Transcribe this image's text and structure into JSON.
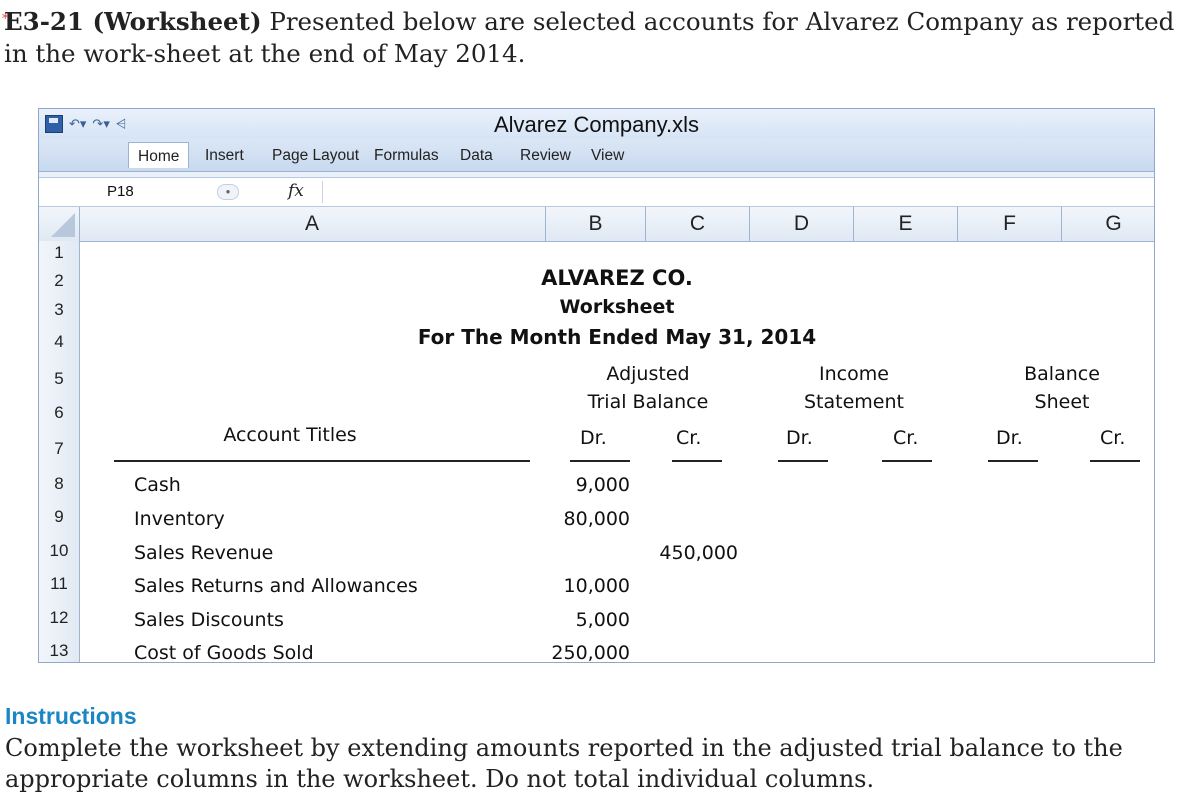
{
  "problem": {
    "label": "E3-21 (Worksheet)",
    "text": "Presented below are selected accounts for Alvarez Company as reported in the work-sheet at the end of May 2014."
  },
  "excel": {
    "window_title": "Alvarez Company.xls",
    "tabs": [
      "Home",
      "Insert",
      "Page Layout",
      "Formulas",
      "Data",
      "Review",
      "View"
    ],
    "active_tab": "Home",
    "name_box": "P18",
    "fx_label": "fx",
    "columns": [
      "A",
      "B",
      "C",
      "D",
      "E",
      "F",
      "G"
    ],
    "rows": [
      "1",
      "2",
      "3",
      "4",
      "5",
      "6",
      "7",
      "8",
      "9",
      "10",
      "11",
      "12",
      "13"
    ],
    "header": {
      "company": "ALVAREZ CO.",
      "report": "Worksheet",
      "period": "For The Month Ended May 31, 2014"
    },
    "groups": {
      "atb_line1": "Adjusted",
      "atb_line2": "Trial Balance",
      "is_line1": "Income",
      "is_line2": "Statement",
      "bs_line1": "Balance",
      "bs_line2": "Sheet"
    },
    "col_titles": {
      "account": "Account Titles",
      "dr": "Dr.",
      "cr": "Cr."
    },
    "accounts": [
      {
        "name": "Cash",
        "dr": "9,000",
        "cr": ""
      },
      {
        "name": "Inventory",
        "dr": "80,000",
        "cr": ""
      },
      {
        "name": "Sales Revenue",
        "dr": "",
        "cr": "450,000"
      },
      {
        "name": "Sales Returns and Allowances",
        "dr": "10,000",
        "cr": ""
      },
      {
        "name": "Sales Discounts",
        "dr": "5,000",
        "cr": ""
      },
      {
        "name": "Cost of Goods Sold",
        "dr": "250,000",
        "cr": ""
      }
    ]
  },
  "instructions": {
    "title": "Instructions",
    "text": "Complete the worksheet by extending amounts reported in the adjusted trial balance to the appropriate columns in the worksheet. Do not total individual columns."
  },
  "colors": {
    "instructions_title": "#1a86c4",
    "ribbon": "#c8d9ee",
    "star": "#d9463a"
  }
}
